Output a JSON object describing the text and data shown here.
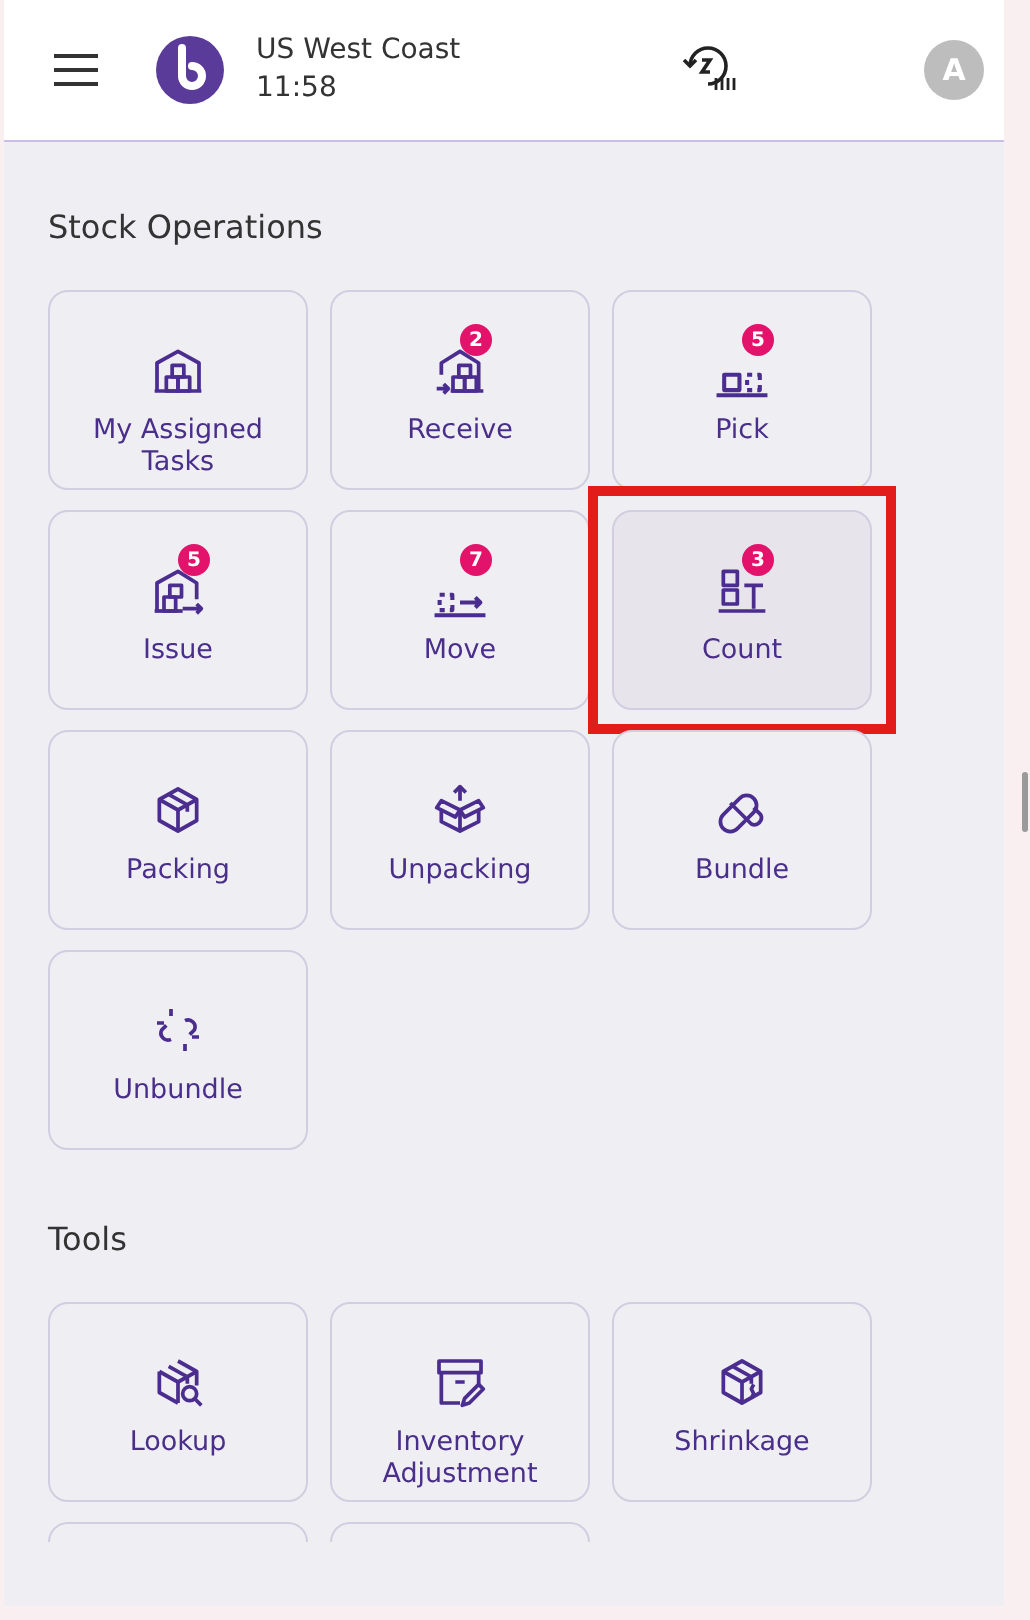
{
  "header": {
    "location": "US West Coast",
    "time": "11:58",
    "avatar": "A"
  },
  "sections": [
    {
      "title": "Stock Operations",
      "tiles": [
        {
          "kind": "warehouse",
          "label": "My Assigned Tasks",
          "selected": false,
          "highlighted": false
        },
        {
          "kind": "receive",
          "label": "Receive",
          "badge": "2",
          "selected": false,
          "highlighted": false
        },
        {
          "kind": "pick",
          "label": "Pick",
          "badge": "5",
          "selected": false,
          "highlighted": false
        },
        {
          "kind": "issue",
          "label": "Issue",
          "badge": "5",
          "selected": false,
          "highlighted": false
        },
        {
          "kind": "move",
          "label": "Move",
          "badge": "7",
          "selected": false,
          "highlighted": false
        },
        {
          "kind": "count",
          "label": "Count",
          "badge": "3",
          "selected": true,
          "highlighted": true
        },
        {
          "kind": "pack",
          "label": "Packing",
          "selected": false,
          "highlighted": false
        },
        {
          "kind": "unpack",
          "label": "Unpacking",
          "selected": false,
          "highlighted": false
        },
        {
          "kind": "bundle",
          "label": "Bundle",
          "selected": false,
          "highlighted": false
        },
        {
          "kind": "unbundle",
          "label": "Unbundle",
          "selected": false,
          "highlighted": false
        }
      ]
    },
    {
      "title": "Tools",
      "tiles": [
        {
          "kind": "lookup",
          "label": "Lookup",
          "selected": false,
          "highlighted": false
        },
        {
          "kind": "adjust",
          "label": "Inventory Adjustment",
          "selected": false,
          "highlighted": false
        },
        {
          "kind": "shrink",
          "label": "Shrinkage",
          "selected": false,
          "highlighted": false
        },
        {
          "kind": "partial"
        },
        {
          "kind": "partial"
        }
      ]
    }
  ]
}
